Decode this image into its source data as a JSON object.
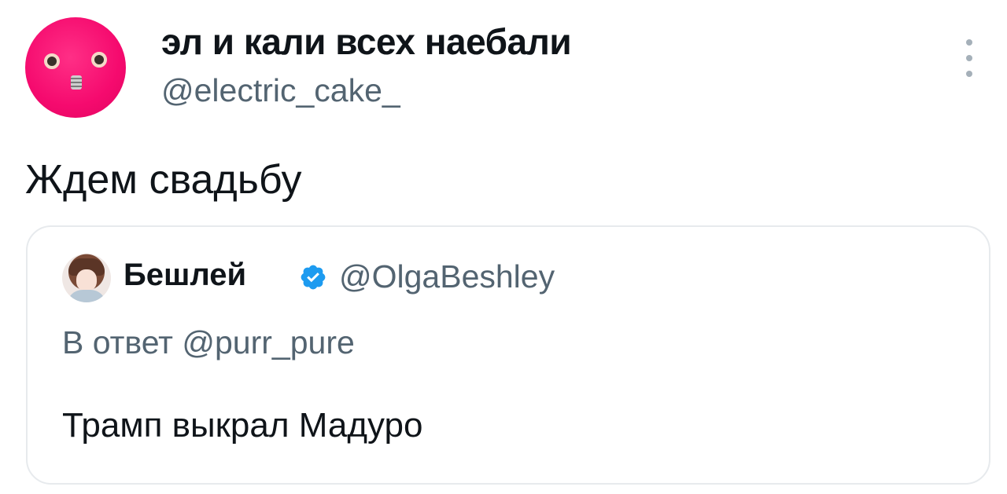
{
  "tweet": {
    "author": {
      "display_name": "эл и кали всех наебали",
      "handle": "@electric_cake_",
      "avatar_icon": "pink-face-avatar"
    },
    "more_icon": "more-vertical-icon",
    "text": "Ждем свадьбу"
  },
  "quoted_tweet": {
    "author": {
      "display_name": "Бешлей",
      "handle": "@OlgaBeshley",
      "verified_icon": "verified-badge-icon",
      "avatar_icon": "user-photo-avatar"
    },
    "reply_prefix": "В ответ",
    "reply_to": "@purr_pure",
    "text": "Трамп выкрал Мадуро"
  },
  "colors": {
    "text_primary": "#0f1419",
    "text_secondary": "#536471",
    "verified_blue": "#1d9bf0",
    "avatar_pink": "#f50a6e",
    "border": "#e7eaed"
  }
}
